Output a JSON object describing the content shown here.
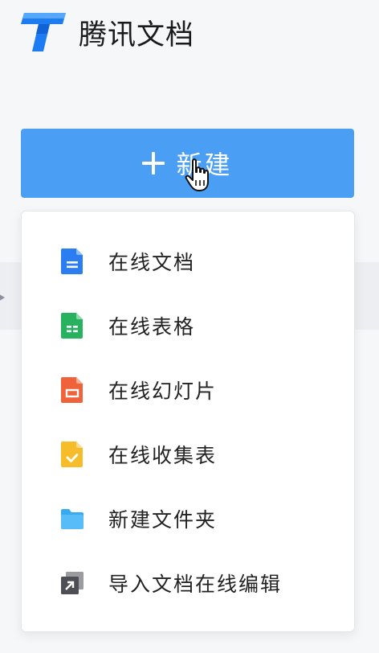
{
  "app": {
    "name": "腾讯文档",
    "brand_color": "#1e7cf2"
  },
  "new_button": {
    "label": "新建",
    "icon": "plus-icon",
    "color": "#4a9ff5"
  },
  "menu": {
    "items": [
      {
        "label": "在线文档",
        "icon": "doc-icon",
        "color": "#2b7ef1"
      },
      {
        "label": "在线表格",
        "icon": "sheet-icon",
        "color": "#27b25f"
      },
      {
        "label": "在线幻灯片",
        "icon": "slide-icon",
        "color": "#f0623a"
      },
      {
        "label": "在线收集表",
        "icon": "form-icon",
        "color": "#f7bc2a"
      },
      {
        "label": "新建文件夹",
        "icon": "folder-icon",
        "color": "#3aaaf0"
      },
      {
        "label": "导入文档在线编辑",
        "icon": "import-icon",
        "color": "#4d4f54"
      }
    ]
  }
}
